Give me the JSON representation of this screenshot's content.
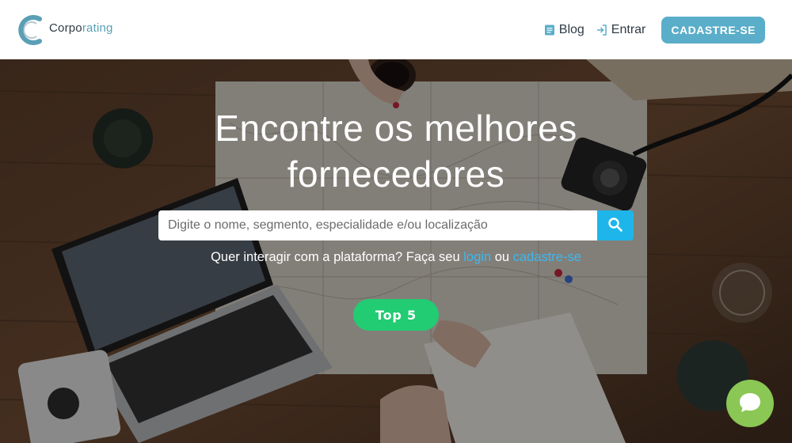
{
  "brand": {
    "name_prefix": "Corpo",
    "name_suffix": "rating",
    "accent_color": "#5a9fb5"
  },
  "nav": {
    "blog_label": "Blog",
    "login_label": "Entrar",
    "signup_label": "CADASTRE-SE",
    "signup_color": "#5aaec9"
  },
  "hero": {
    "title_line1": "Encontre os melhores",
    "title_line2": "fornecedores",
    "search_placeholder": "Digite o nome, segmento, especialidade e/ou localização",
    "search_button_color": "#1eb6ea",
    "cta_text": "Quer interagir com a plataforma? Faça seu",
    "cta_login": "login",
    "cta_or": "ou",
    "cta_signup": "cadastre-se",
    "top5_label": "Top 5",
    "top5_color": "#22cc72"
  },
  "chat": {
    "color": "#8ac755",
    "icon": "chat-bubble-icon"
  }
}
